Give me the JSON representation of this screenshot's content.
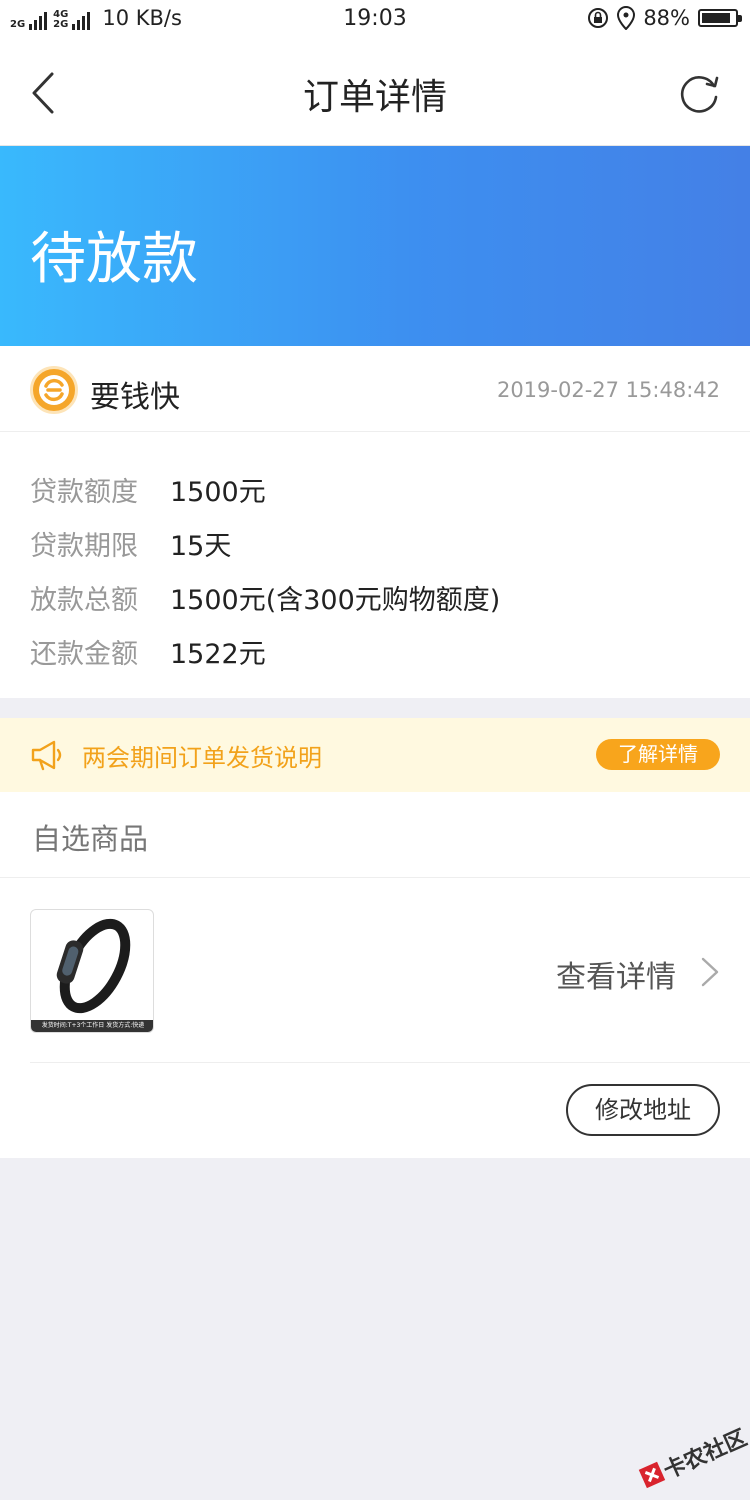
{
  "status_bar": {
    "net_top": "2G",
    "net_bottom": "4G",
    "net_bottom2": "2G",
    "speed": "10 KB/s",
    "time": "19:03",
    "battery": "88%",
    "battery_level": 0.88
  },
  "nav": {
    "title": "订单详情",
    "back_icon": "chevron-left-icon",
    "refresh_icon": "refresh-icon"
  },
  "order": {
    "status": "待放款",
    "merchant_name": "要钱快",
    "created_at": "2019-02-27 15:48:42",
    "details": [
      {
        "label": "贷款额度",
        "value": "1500元"
      },
      {
        "label": "贷款期限",
        "value": "15天"
      },
      {
        "label": "放款总额",
        "value": "1500元(含300元购物额度)"
      },
      {
        "label": "还款金额",
        "value": "1522元"
      }
    ]
  },
  "notice": {
    "text": "两会期间订单发货说明",
    "button": "了解详情"
  },
  "goods": {
    "section_title": "自选商品",
    "product_caption": "发货时间:T+3个工作日 发货方式:快递",
    "view_detail": "查看详情",
    "modify_address": "修改地址"
  },
  "watermark": {
    "text": "卡农社区"
  },
  "colors": {
    "hero_start": "#39b9fd",
    "hero_end": "#4480e6",
    "accent_orange": "#f8a51c",
    "notice_bg": "#fff9e0"
  }
}
